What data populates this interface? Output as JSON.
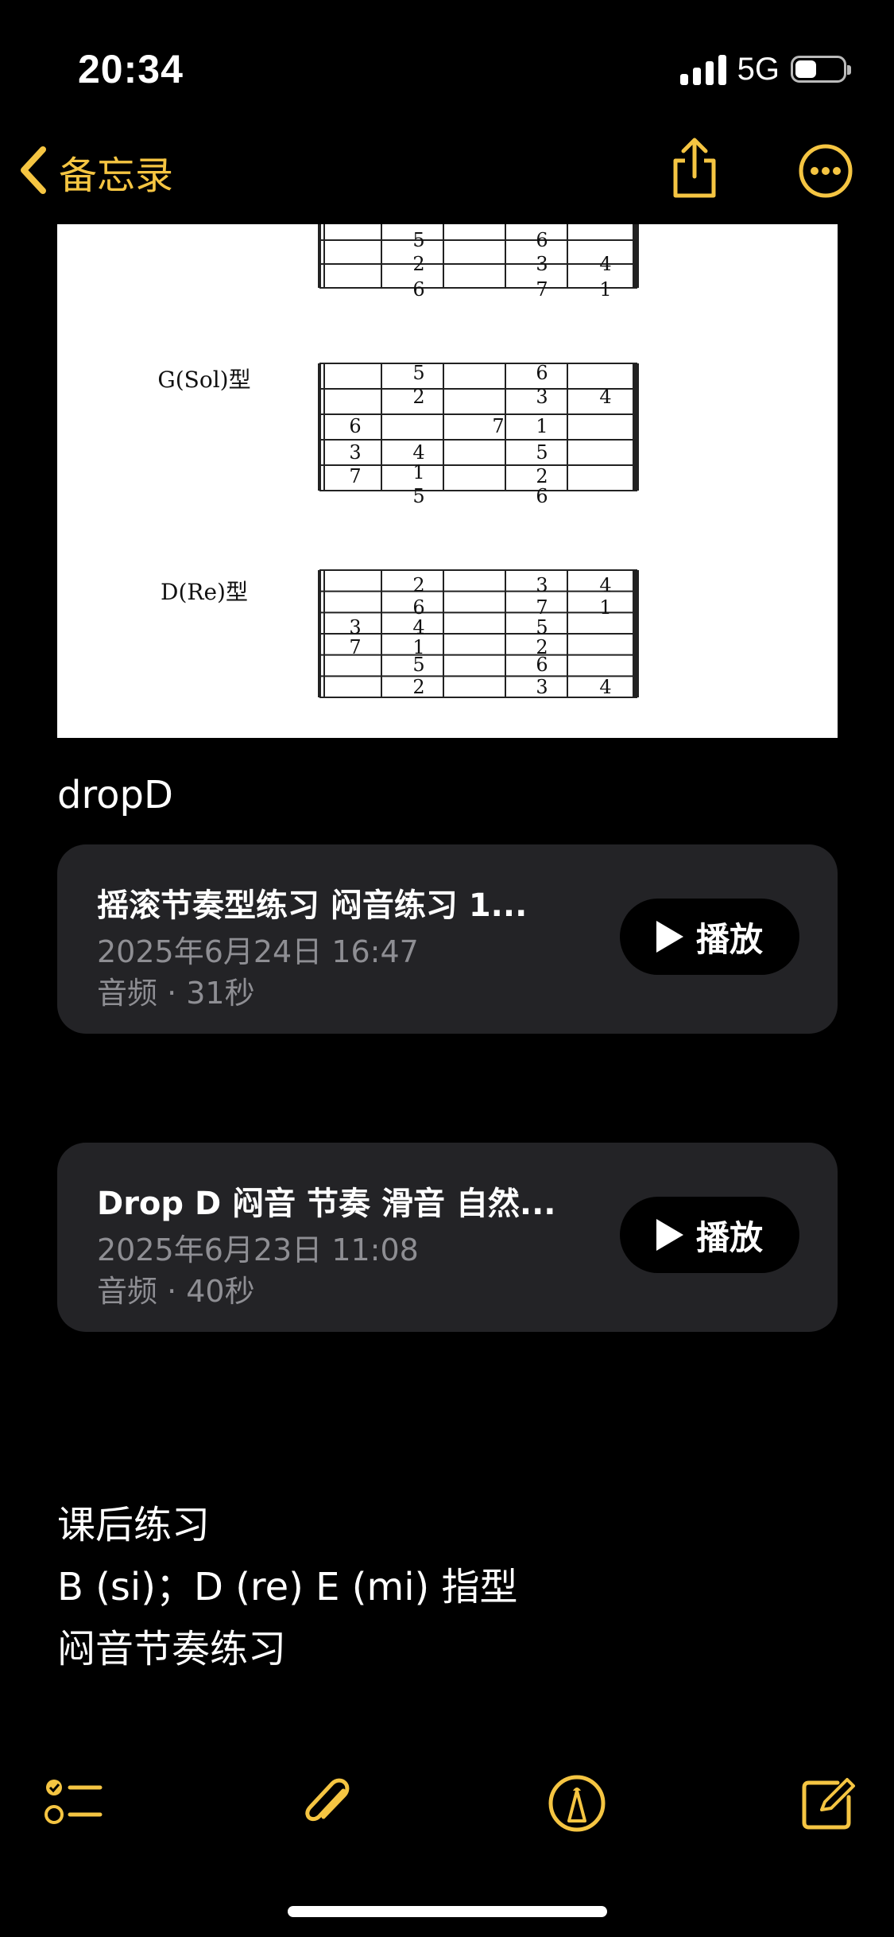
{
  "status_bar": {
    "time": "20:34",
    "network": "5G",
    "signal_bars": 4,
    "battery_level": 0.45
  },
  "nav": {
    "back_label": "备忘录",
    "icons": [
      "chevron-left-icon",
      "share-icon",
      "more-icon"
    ]
  },
  "image": {
    "rows": [
      {
        "label": "",
        "notes": [
          [
            "5",
            "2",
            "6"
          ],
          [
            "6",
            "3",
            "7"
          ],
          [
            "4",
            "1"
          ]
        ]
      },
      {
        "label": "G(Sol)型",
        "notes": [
          "5",
          "2",
          "6",
          "3",
          "7",
          "4",
          "1",
          "5",
          "7",
          "6",
          "3",
          "1",
          "5",
          "2",
          "6",
          "4"
        ]
      },
      {
        "label": "D(Re)型",
        "notes": [
          "2",
          "6",
          "3",
          "7",
          "4",
          "1",
          "5",
          "2",
          "3",
          "7",
          "5",
          "2",
          "6",
          "3",
          "4",
          "1",
          "4"
        ]
      }
    ]
  },
  "section_label": "dropD",
  "audio_items": [
    {
      "title": "摇滚节奏型练习 闷音练习 1...",
      "date": "2025年6月24日 16:47",
      "meta": "音频 · 31秒",
      "button": "播放"
    },
    {
      "title": "Drop D 闷音 节奏 滑音 自然...",
      "date": "2025年6月23日 11:08",
      "meta": "音频 · 40秒",
      "button": "播放"
    }
  ],
  "homework": {
    "heading": "课后练习",
    "line1": "B (si)；D (re) E (mi) 指型",
    "line2": "闷音节奏练习"
  },
  "toolbar": {
    "icons": [
      "checklist-icon",
      "paperclip-icon",
      "markup-icon",
      "compose-icon"
    ]
  },
  "colors": {
    "accent": "#f5c542",
    "card_bg": "#232326",
    "secondary_text": "#8e8e93"
  }
}
